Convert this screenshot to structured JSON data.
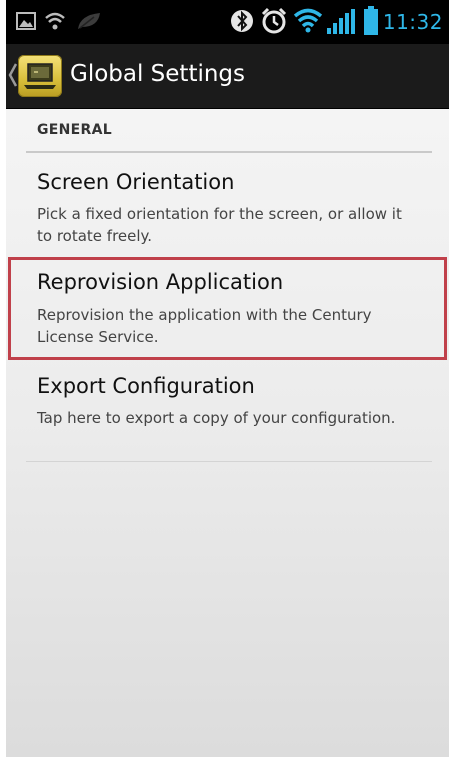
{
  "status_bar": {
    "icons": [
      "gallery-icon",
      "wifi-small-icon",
      "leaf-icon",
      "bluetooth-icon",
      "alarm-icon",
      "wifi-icon",
      "signal-icon",
      "battery-icon"
    ],
    "time": "11:32",
    "accent_color": "#2fb7e8"
  },
  "action_bar": {
    "title": "Global Settings",
    "app_icon": "laptop-icon"
  },
  "settings": {
    "section_header": "GENERAL",
    "items": [
      {
        "title": "Screen Orientation",
        "summary": "Pick a fixed orientation for the screen, or allow it to rotate freely."
      },
      {
        "title": "Reprovision Application",
        "summary": "Reprovision the application with the Century License Service."
      },
      {
        "title": "Export Configuration",
        "summary": "Tap here to export a copy of your configuration."
      }
    ]
  },
  "highlight_color": "#c0404a"
}
